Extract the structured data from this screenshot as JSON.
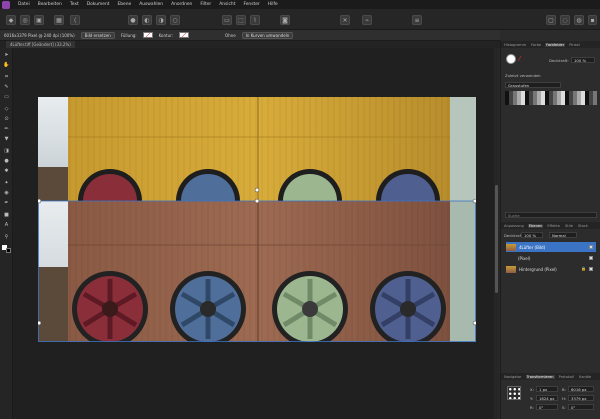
{
  "menu": [
    "Datei",
    "Bearbeiten",
    "Text",
    "Dokument",
    "Ebene",
    "Auswahlen",
    "Anordnen",
    "Filter",
    "Ansicht",
    "Fenster",
    "Hilfe"
  ],
  "context": {
    "dimensions": "6016x3379 Pixel @ 240 dpi (100%)",
    "replace_image": "Bild ersetzen",
    "fill_label": "Füllung:",
    "stroke_label": "Kontur:",
    "stroke_none": "Ohne",
    "convert_curves": "In Kurven umwandeln"
  },
  "doc_tab": "4Lüfter.tiff [Geändert] (33.2%)",
  "panel": {
    "top_tabs": [
      "Histogramm",
      "Farbe",
      "Farbfelder",
      "Pinsel"
    ],
    "active_top_tab": "Farbfelder",
    "opacity_label": "Deckkraft:",
    "opacity_value": "100 %",
    "recent_label": "Zuletzt verwendet:",
    "palette": "Graustufen",
    "search_placeholder": "Suche",
    "layer_tabs": [
      "Anpassung",
      "Ebenen",
      "Effekte",
      "Stile",
      "Stock"
    ],
    "active_layer_tab": "Ebenen",
    "layer_opacity_label": "Deckkraft:",
    "layer_opacity_value": "100 %",
    "blend_mode": "Normal",
    "layers": [
      {
        "name": "4Lüfter (Bild)",
        "selected": true
      },
      {
        "name": "(Pixel)",
        "selected": false
      },
      {
        "name": "Hintergrund (Pixel)",
        "selected": false
      }
    ],
    "bottom_tabs": [
      "Navigator",
      "Transformieren",
      "Protokoll",
      "Kanäle"
    ],
    "active_bottom_tab": "Transformieren",
    "transform": {
      "x": "1 px",
      "w": "6016 px",
      "y": "1624 px",
      "h": "3379 px",
      "r": "0°",
      "s": "0°"
    }
  },
  "colors": {
    "accent": "#3b74c4",
    "logo": "#8e44ad",
    "fan_colors": [
      "#8a2f3a",
      "#4f6f9a",
      "#9cb690",
      "#4f5f8f"
    ]
  }
}
